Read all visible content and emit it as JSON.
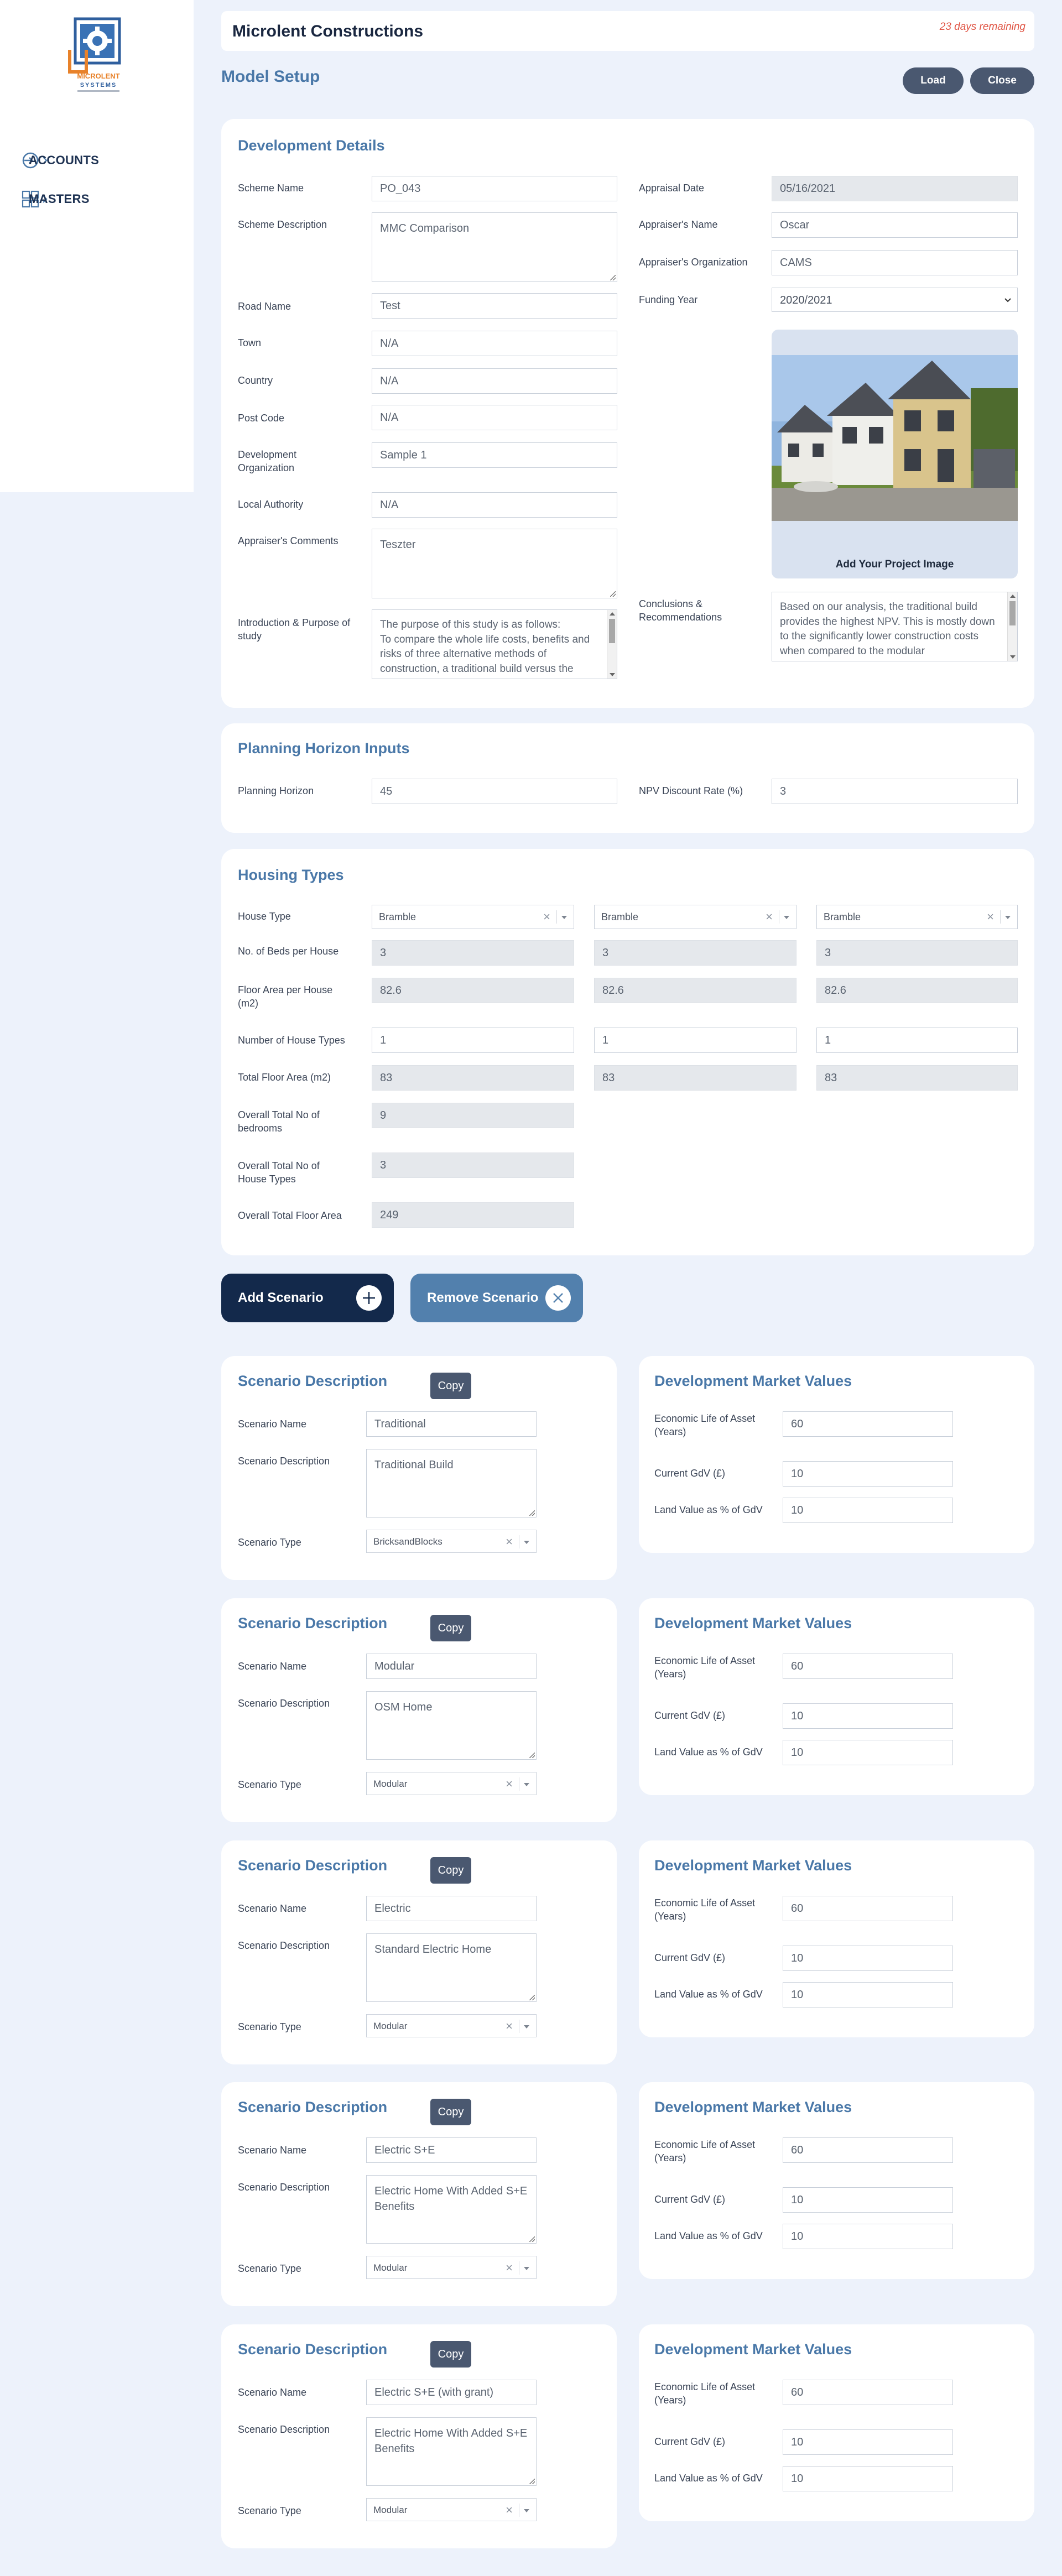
{
  "app": {
    "title": "Microlent Constructions",
    "trial_notice": "23 days remaining",
    "logo_line1": "MICROLENT",
    "logo_line2": "SYSTEMS"
  },
  "sidebar": {
    "items": [
      {
        "label": "ACCOUNTS"
      },
      {
        "label": "MASTERS"
      }
    ]
  },
  "page": {
    "title": "Model Setup",
    "load_label": "Load",
    "close_label": "Close"
  },
  "development": {
    "title": "Development Details",
    "scheme_name": {
      "label": "Scheme Name",
      "value": "PO_043"
    },
    "scheme_description": {
      "label": "Scheme Description",
      "value": "MMC Comparison"
    },
    "road_name": {
      "label": "Road Name",
      "value": "Test"
    },
    "town": {
      "label": "Town",
      "value": "N/A"
    },
    "country": {
      "label": "Country",
      "value": "N/A"
    },
    "post_code": {
      "label": "Post Code",
      "value": "N/A"
    },
    "dev_org": {
      "label": "Development Organization",
      "value": "Sample 1"
    },
    "local_authority": {
      "label": "Local Authority",
      "value": "N/A"
    },
    "appraiser_comments": {
      "label": "Appraiser's Comments",
      "value": "Teszter"
    },
    "intro": {
      "label": "Introduction & Purpose of study",
      "value": "The purpose of this study is as follows:\nTo compare the whole life costs, benefits and risks of three alternative methods of construction, a traditional build versus the"
    },
    "appraisal_date": {
      "label": "Appraisal Date",
      "value": "05/16/2021"
    },
    "appraiser_name": {
      "label": "Appraiser's Name",
      "value": "Oscar"
    },
    "appraiser_org": {
      "label": "Appraiser's Organization",
      "value": "CAMS"
    },
    "funding_year": {
      "label": "Funding Year",
      "value": "2020/2021"
    },
    "project_image_caption": "Add Your Project Image",
    "conclusions": {
      "label": "Conclusions & Recommendations",
      "value": "Based on our analysis, the traditional build provides the highest NPV. This is mostly down to the significantly lower construction costs when compared to the modular"
    }
  },
  "planning": {
    "title": "Planning Horizon Inputs",
    "horizon": {
      "label": "Planning Horizon",
      "value": "45"
    },
    "npv_rate": {
      "label": "NPV Discount Rate (%)",
      "value": "3"
    }
  },
  "housing": {
    "title": "Housing Types",
    "labels": {
      "house_type": "House Type",
      "beds": "No. of Beds per House",
      "floor_area": "Floor Area per House (m2)",
      "num_types": "Number of House Types",
      "total_floor": "Total Floor Area (m2)",
      "overall_bedrooms": "Overall Total No of bedrooms",
      "overall_types": "Overall Total No of House Types",
      "overall_floor": "Overall Total Floor Area"
    },
    "columns": [
      {
        "house_type": "Bramble",
        "beds": "3",
        "floor_area": "82.6",
        "num_types": "1",
        "total_floor": "83"
      },
      {
        "house_type": "Bramble",
        "beds": "3",
        "floor_area": "82.6",
        "num_types": "1",
        "total_floor": "83"
      },
      {
        "house_type": "Bramble",
        "beds": "3",
        "floor_area": "82.6",
        "num_types": "1",
        "total_floor": "83"
      }
    ],
    "overall_bedrooms": "9",
    "overall_types": "3",
    "overall_floor": "249"
  },
  "actions": {
    "add_scenario": "Add Scenario",
    "remove_scenario": "Remove Scenario"
  },
  "scenario_labels": {
    "desc_title": "Scenario Description",
    "copy": "Copy",
    "name": "Scenario Name",
    "description": "Scenario Description",
    "type": "Scenario Type",
    "market_title": "Development Market Values",
    "econ_life": "Economic Life of Asset (Years)",
    "gdv": "Current GdV (£)",
    "land_value": "Land Value as % of GdV"
  },
  "scenarios": [
    {
      "name": "Traditional",
      "description": "Traditional Build",
      "type": "BricksandBlocks",
      "econ_life": "60",
      "gdv": "10",
      "land_value": "10"
    },
    {
      "name": "Modular",
      "description": "OSM Home",
      "type": "Modular",
      "econ_life": "60",
      "gdv": "10",
      "land_value": "10"
    },
    {
      "name": "Electric",
      "description": "Standard Electric Home",
      "type": "Modular",
      "econ_life": "60",
      "gdv": "10",
      "land_value": "10"
    },
    {
      "name": "Electric S+E",
      "description": "Electric Home With Added S+E Benefits",
      "type": "Modular",
      "econ_life": "60",
      "gdv": "10",
      "land_value": "10"
    },
    {
      "name": "Electric S+E (with grant)",
      "description": "Electric Home With Added S+E Benefits",
      "type": "Modular",
      "econ_life": "60",
      "gdv": "10",
      "land_value": "10"
    }
  ]
}
